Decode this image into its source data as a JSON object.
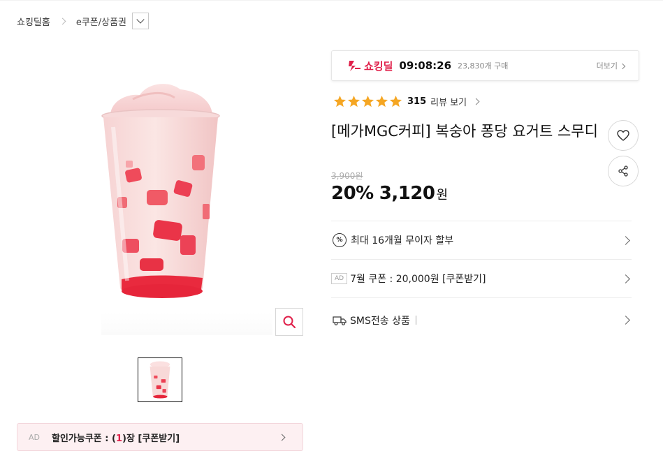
{
  "breadcrumb": {
    "home": "쇼킹딜홈",
    "category": "e쿠폰/상품권"
  },
  "deal": {
    "logo_text": "쇼킹딜",
    "timer": "09:08:26",
    "buyers": "23,830개 구매",
    "more": "더보기",
    "accent": "#e0204a"
  },
  "rating": {
    "stars": 5,
    "count": "315",
    "link": "리뷰 보기",
    "star_color": "#f5a623"
  },
  "product": {
    "title": "[메가MGC커피] 복숭아 퐁당 요거트 스무디",
    "original_price": "3,900원",
    "discount": "20%",
    "price": "3,120",
    "currency": "원"
  },
  "info_rows": {
    "installment": {
      "icon": "percent-icon",
      "text": "최대 16개월 무이자 할부"
    },
    "coupon": {
      "ad": "AD",
      "text": "7월 쿠폰 : 20,000원 [쿠폰받기]"
    },
    "sms": {
      "icon": "truck-icon",
      "text": "SMS전송 상품"
    }
  },
  "coupon_bar": {
    "ad": "AD",
    "text_before": "할인가능쿠폰 : (",
    "count": "1",
    "text_after": ")장 [쿠폰받기]"
  },
  "icons": {
    "wish": "heart-icon",
    "share": "share-icon",
    "zoom": "search-icon"
  }
}
